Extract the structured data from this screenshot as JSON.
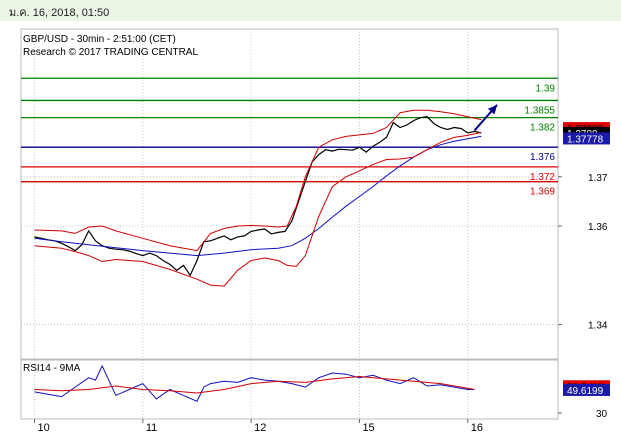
{
  "header": {
    "timestamp": "ม.ค. 16, 2018, 01:50"
  },
  "chart_data": [
    {
      "type": "line",
      "title": "GBP/USD - 30min - 2:51:00 (CET)",
      "subtitle": "Research © 2017 TRADING CENTRAL",
      "ylim": [
        1.333,
        1.4
      ],
      "y_ticks": [
        {
          "value": 1.37,
          "label": "1.37"
        },
        {
          "value": 1.36,
          "label": "1.36"
        },
        {
          "value": 1.34,
          "label": "1.34"
        }
      ],
      "x_ticks": [
        {
          "x": 0,
          "label": "10"
        },
        {
          "x": 48,
          "label": "11"
        },
        {
          "x": 96,
          "label": "12"
        },
        {
          "x": 144,
          "label": "15"
        },
        {
          "x": 192,
          "label": "16"
        }
      ],
      "xlim": [
        -6,
        232
      ],
      "levels": [
        {
          "value": 1.39,
          "label": "1.39",
          "color": "#008000"
        },
        {
          "value": 1.3855,
          "label": "1.3855",
          "color": "#008000"
        },
        {
          "value": 1.382,
          "label": "1.382",
          "color": "#008000"
        },
        {
          "value": 1.376,
          "label": "1.376",
          "color": "#00008b"
        },
        {
          "value": 1.372,
          "label": "1.372",
          "color": "#dd0000"
        },
        {
          "value": 1.369,
          "label": "1.369",
          "color": "#dd0000"
        }
      ],
      "price_tags": [
        {
          "value": 1.37988,
          "label": "1.37988",
          "bg": "#e00000",
          "fg": "#000000"
        },
        {
          "value": 1.3789,
          "label": "1.3789",
          "bg": "#000000",
          "fg": "#ffffff"
        },
        {
          "value": 1.37778,
          "label": "1.37778",
          "bg": "#1a1aa8",
          "fg": "#ffffff"
        }
      ],
      "arrow": {
        "from": [
          195,
          1.3794
        ],
        "to": [
          205,
          1.3846
        ],
        "color": "#00008b"
      },
      "series": [
        {
          "name": "price",
          "color": "#000000",
          "x": [
            0,
            3,
            6,
            9,
            12,
            15,
            18,
            21,
            24,
            27,
            30,
            33,
            36,
            39,
            42,
            45,
            48,
            51,
            54,
            57,
            60,
            63,
            66,
            69,
            72,
            75,
            78,
            81,
            84,
            87,
            90,
            93,
            96,
            99,
            102,
            105,
            108,
            111,
            114,
            117,
            120,
            123,
            126,
            129,
            132,
            135,
            138,
            141,
            144,
            147,
            150,
            153,
            156,
            159,
            162,
            165,
            168,
            171,
            174,
            177,
            180,
            183,
            186,
            189,
            192,
            195,
            198
          ],
          "values": [
            1.3578,
            1.3575,
            1.3572,
            1.357,
            1.3565,
            1.3558,
            1.355,
            1.3562,
            1.359,
            1.357,
            1.356,
            1.3555,
            1.3553,
            1.3552,
            1.3549,
            1.3544,
            1.354,
            1.3545,
            1.354,
            1.353,
            1.3522,
            1.351,
            1.352,
            1.35,
            1.353,
            1.3568,
            1.357,
            1.3575,
            1.358,
            1.3572,
            1.3578,
            1.358,
            1.3589,
            1.3592,
            1.3594,
            1.3584,
            1.3587,
            1.3589,
            1.361,
            1.365,
            1.369,
            1.373,
            1.3745,
            1.3755,
            1.3752,
            1.3756,
            1.3755,
            1.3754,
            1.376,
            1.375,
            1.3762,
            1.377,
            1.378,
            1.381,
            1.38,
            1.3805,
            1.3814,
            1.382,
            1.3822,
            1.3808,
            1.38,
            1.3796,
            1.38,
            1.3798,
            1.3789,
            1.3792,
            1.3789
          ]
        },
        {
          "name": "ma",
          "color": "#1010c0",
          "x": [
            0,
            12,
            24,
            36,
            48,
            60,
            72,
            84,
            96,
            108,
            114,
            120,
            126,
            132,
            138,
            144,
            150,
            156,
            162,
            168,
            174,
            180,
            186,
            192,
            198
          ],
          "values": [
            1.3575,
            1.3568,
            1.3562,
            1.3556,
            1.355,
            1.3545,
            1.354,
            1.3545,
            1.3552,
            1.3555,
            1.356,
            1.3575,
            1.3595,
            1.3618,
            1.364,
            1.366,
            1.368,
            1.3702,
            1.3722,
            1.374,
            1.3755,
            1.3765,
            1.3772,
            1.3777,
            1.3782
          ]
        },
        {
          "name": "bb-upper",
          "color": "#d00000",
          "x": [
            0,
            12,
            18,
            24,
            30,
            36,
            48,
            60,
            72,
            78,
            84,
            90,
            96,
            102,
            108,
            112,
            116,
            120,
            126,
            132,
            138,
            144,
            150,
            156,
            162,
            168,
            174,
            180,
            186,
            192,
            198
          ],
          "values": [
            1.3592,
            1.359,
            1.3585,
            1.3598,
            1.36,
            1.359,
            1.3575,
            1.356,
            1.355,
            1.3585,
            1.3595,
            1.36,
            1.3601,
            1.36,
            1.3598,
            1.36,
            1.364,
            1.37,
            1.376,
            1.3775,
            1.3782,
            1.3785,
            1.3788,
            1.38,
            1.383,
            1.3835,
            1.3835,
            1.3832,
            1.3828,
            1.3822,
            1.3816
          ]
        },
        {
          "name": "bb-lower",
          "color": "#d00000",
          "x": [
            0,
            12,
            18,
            24,
            30,
            36,
            48,
            60,
            72,
            78,
            84,
            90,
            96,
            102,
            108,
            112,
            116,
            120,
            126,
            132,
            138,
            144,
            150,
            156,
            162,
            168,
            174,
            180,
            186,
            192,
            198
          ],
          "values": [
            1.356,
            1.3555,
            1.3548,
            1.354,
            1.3528,
            1.3532,
            1.3528,
            1.3512,
            1.3492,
            1.348,
            1.3478,
            1.351,
            1.353,
            1.3535,
            1.353,
            1.352,
            1.3518,
            1.354,
            1.362,
            1.368,
            1.37,
            1.3712,
            1.3725,
            1.3735,
            1.3736,
            1.374,
            1.3755,
            1.377,
            1.378,
            1.3784,
            1.379
          ]
        }
      ]
    },
    {
      "type": "line",
      "title": "RSI14 - 9MA",
      "ylim": [
        25,
        75
      ],
      "y_ticks": [
        {
          "value": 30,
          "label": "30"
        }
      ],
      "xlim": [
        -6,
        232
      ],
      "price_tags": [
        {
          "value": 52.7403,
          "label": "52.7403",
          "bg": "#e00000",
          "fg": "#000000"
        },
        {
          "value": 49.6199,
          "label": "49.6199",
          "bg": "#1a1aa8",
          "fg": "#ffffff"
        }
      ],
      "series": [
        {
          "name": "rsi",
          "color": "#1010c0",
          "x": [
            0,
            6,
            12,
            18,
            24,
            27,
            30,
            36,
            42,
            48,
            54,
            60,
            66,
            72,
            75,
            78,
            84,
            90,
            96,
            102,
            108,
            114,
            120,
            126,
            132,
            138,
            144,
            150,
            156,
            162,
            168,
            174,
            180,
            186,
            192,
            195
          ],
          "values": [
            48,
            46,
            44,
            52,
            60,
            58,
            70,
            45,
            50,
            55,
            42,
            50,
            45,
            40,
            52,
            55,
            57,
            56,
            60,
            58,
            57,
            55,
            52,
            60,
            64,
            63,
            60,
            62,
            58,
            55,
            60,
            53,
            54,
            52,
            50,
            50
          ]
        },
        {
          "name": "rsi-ma",
          "color": "#d00000",
          "x": [
            0,
            12,
            24,
            36,
            48,
            60,
            72,
            84,
            96,
            108,
            120,
            132,
            144,
            156,
            168,
            180,
            192,
            195
          ],
          "values": [
            50,
            49,
            50,
            53,
            50,
            49,
            47,
            50,
            55,
            57,
            56,
            59,
            61,
            59,
            57,
            55,
            51,
            50
          ]
        }
      ]
    }
  ]
}
